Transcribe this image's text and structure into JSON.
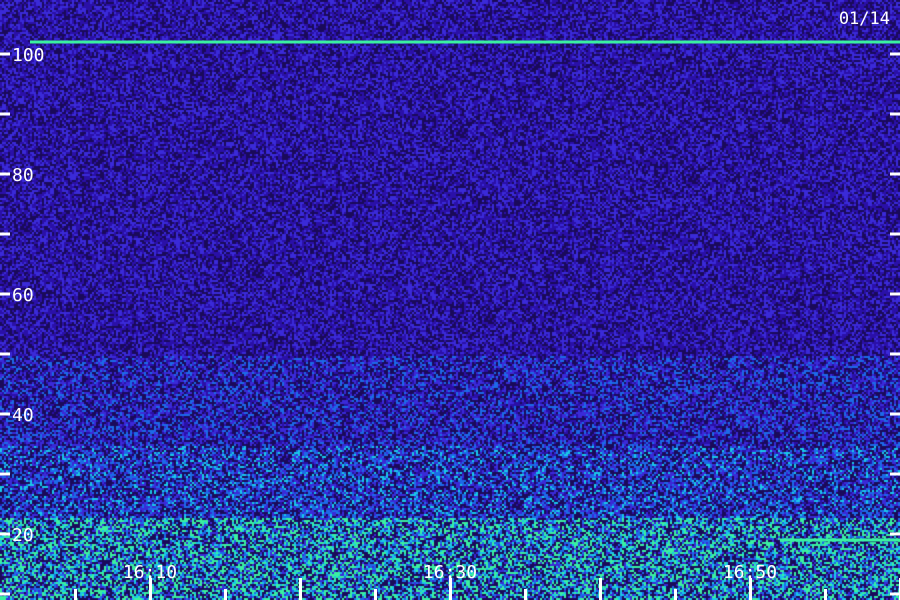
{
  "chart_data": {
    "type": "heatmap",
    "title": "",
    "date_label": "01/14",
    "xlabel": "",
    "ylabel": "",
    "x_ticks": [
      "16:10",
      "16:30",
      "16:50"
    ],
    "y_ticks": [
      100,
      80,
      60,
      40,
      20
    ],
    "y_range": [
      8,
      103
    ],
    "x_range": [
      "16:02",
      "17:02"
    ],
    "colormap": [
      "#1a0a5a",
      "#2a10a8",
      "#3a2ad8",
      "#1c6ae8",
      "#19c8e8",
      "#3af0a0"
    ],
    "background_level": 0.15,
    "persistent_lines": [
      {
        "freq": 102,
        "start": "16:02",
        "end": "17:02",
        "level": 1.0
      },
      {
        "freq": 19,
        "start": "16:52",
        "end": "17:02",
        "level": 0.95
      }
    ],
    "band_intensity": [
      {
        "freq_from": 8,
        "freq_to": 23,
        "level": 0.75
      },
      {
        "freq_from": 23,
        "freq_to": 35,
        "level": 0.45
      },
      {
        "freq_from": 35,
        "freq_to": 50,
        "level": 0.3
      },
      {
        "freq_from": 50,
        "freq_to": 103,
        "level": 0.15
      }
    ]
  }
}
